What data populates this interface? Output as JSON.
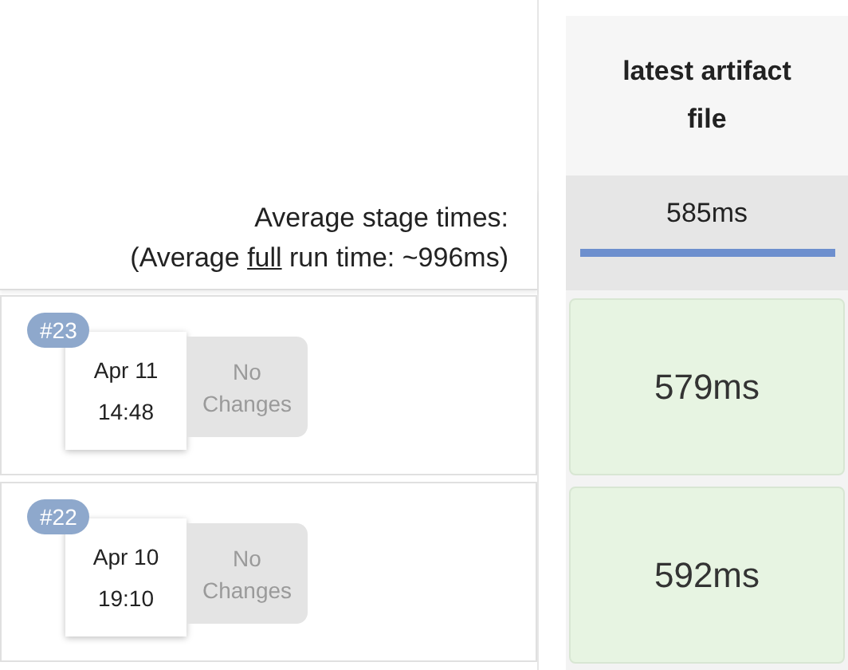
{
  "summary": {
    "title": "Average stage times:",
    "run_time": {
      "before": "(Average ",
      "link": "full",
      "after": " run time: ~996ms)"
    }
  },
  "stage": {
    "name": "latest artifact file",
    "average": "585ms",
    "level": 1
  },
  "builds": [
    {
      "number": "#23",
      "date": "Apr 11",
      "time": "14:48",
      "changes": "No Changes",
      "duration": "579ms",
      "color": "#e7f4e2"
    },
    {
      "number": "#22",
      "date": "Apr 10",
      "time": "19:10",
      "changes": "No Changes",
      "duration": "592ms",
      "color": "#e7f4e2"
    }
  ]
}
